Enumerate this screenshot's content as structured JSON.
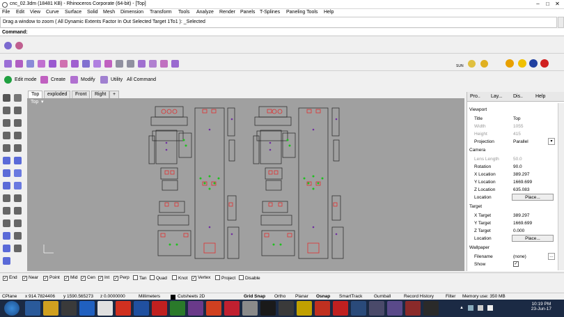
{
  "window": {
    "title": "cnc_02.3dm (18481 KB) - Rhinoceros Corporate (64-bit) - [Top]"
  },
  "menu": [
    "File",
    "Edit",
    "View",
    "Curve",
    "Surface",
    "Solid",
    "Mesh",
    "Dimension",
    "Transform",
    "Tools",
    "Analyze",
    "Render",
    "Panels",
    "T-Splines",
    "Paneling Tools",
    "Help"
  ],
  "command": {
    "history": "Drag a window to zoom ( All  Dynamic  Extents  Factor  In  Out  Selected  Target  1To1 ): _Selected",
    "prompt": "Command:"
  },
  "toolbar2": {
    "edit_mode": "Edit mode",
    "create": "Create",
    "modify": "Modify",
    "utility": "Utility",
    "all_command": "All Command",
    "sun_label": "SUN"
  },
  "viewport_tabs": [
    "Top",
    "exploded",
    "Front",
    "Right",
    "+"
  ],
  "viewport": {
    "label": "Top"
  },
  "panel_tabs": [
    "Pro..",
    "Lay...",
    "Dis..",
    "Help"
  ],
  "properties": {
    "viewport_section": "Viewport",
    "title_k": "Title",
    "title_v": "Top",
    "width_k": "Width",
    "width_v": "1055",
    "height_k": "Height",
    "height_v": "415",
    "projection_k": "Projection",
    "projection_v": "Parallel",
    "camera_section": "Camera",
    "lens_k": "Lens Length",
    "lens_v": "50.0",
    "rotation_k": "Rotation",
    "rotation_v": "90.0",
    "xloc_k": "X Location",
    "xloc_v": "389.297",
    "yloc_k": "Y Location",
    "yloc_v": "1669.699",
    "zloc_k": "Z Location",
    "zloc_v": "635.083",
    "location_k": "Location",
    "place_btn": "Place...",
    "target_section": "Target",
    "xt_k": "X Target",
    "xt_v": "389.297",
    "yt_k": "Y Target",
    "yt_v": "1669.699",
    "zt_k": "Z Target",
    "zt_v": "0.000",
    "tloc_k": "Location",
    "place_btn2": "Place...",
    "wallpaper_section": "Wallpaper",
    "file_k": "Filename",
    "file_v": "(none)",
    "show_k": "Show"
  },
  "osnap": [
    {
      "label": "End",
      "checked": true
    },
    {
      "label": "Near",
      "checked": true
    },
    {
      "label": "Point",
      "checked": true
    },
    {
      "label": "Mid",
      "checked": true
    },
    {
      "label": "Cen",
      "checked": true
    },
    {
      "label": "Int",
      "checked": true
    },
    {
      "label": "Perp",
      "checked": true
    },
    {
      "label": "Tan",
      "checked": false
    },
    {
      "label": "Quad",
      "checked": false
    },
    {
      "label": "Knot",
      "checked": false
    },
    {
      "label": "Vertex",
      "checked": true
    },
    {
      "label": "Project",
      "checked": false
    },
    {
      "label": "Disable",
      "checked": false
    }
  ],
  "status": {
    "cplane": "CPlane",
    "x": "x 914.7824406",
    "y": "y 1590.565273",
    "z": "z 0.0000000",
    "units": "Millimeters",
    "layer": "Cutsheets 2D",
    "grid_snap": "Grid Snap",
    "ortho": "Ortho",
    "planar": "Planar",
    "osnap": "Osnap",
    "smarttrack": "SmartTrack",
    "gumball": "Gumball",
    "record_history": "Record History",
    "filter": "Filter",
    "memory": "Memory use: 350 MB"
  },
  "clock": {
    "time": "10:19 PM",
    "date": "23-Jun-17"
  },
  "colors": {
    "viewport_bg": "#a0a0a0",
    "cut_red": "#e03030",
    "drill_green": "#20c020",
    "mark_purple": "#7030a0",
    "taskbar": "#1b2a44"
  }
}
